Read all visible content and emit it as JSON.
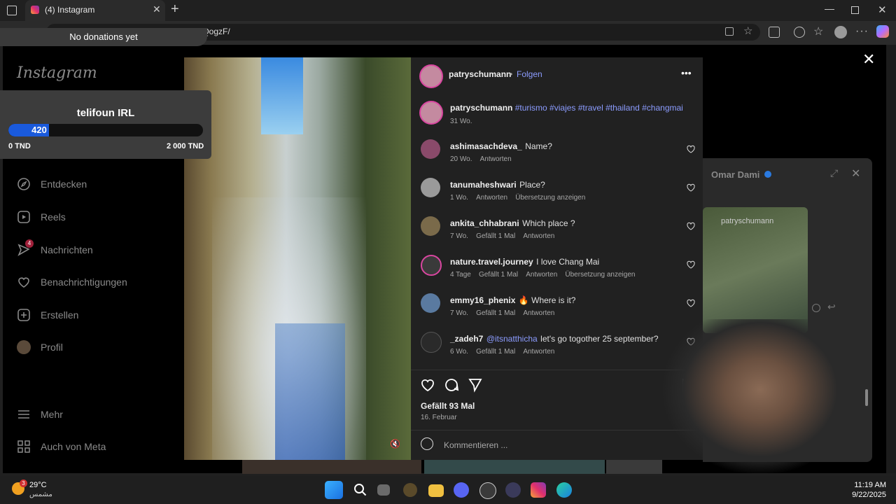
{
  "browser": {
    "tab_title": "(4) Instagram",
    "url": "/QogzF/",
    "new_tab": "+"
  },
  "stream": {
    "donation_text": "No donations yet",
    "goal_title": "telifoun IRL",
    "goal_current": "420",
    "goal_progress": 0.21,
    "goal_min": "0 TND",
    "goal_max": "2 000 TND"
  },
  "sidebar": {
    "logo": "Instagram",
    "items": [
      {
        "label": "Entdecken",
        "icon": "compass-icon"
      },
      {
        "label": "Reels",
        "icon": "reels-icon"
      },
      {
        "label": "Nachrichten",
        "icon": "messenger-icon",
        "badge": "4"
      },
      {
        "label": "Benachrichtigungen",
        "icon": "heart-icon"
      },
      {
        "label": "Erstellen",
        "icon": "plus-square-icon"
      },
      {
        "label": "Profil",
        "icon": "avatar-icon"
      }
    ],
    "more": "Mehr",
    "meta": "Auch von Meta"
  },
  "post": {
    "author": "patryschumann",
    "dot": "•",
    "follow": "Folgen",
    "caption_user": "patryschumann",
    "caption_tags": "#turismo #viajes #travel #thailand #changmai",
    "caption_age": "31 Wo.",
    "likes": "Gefällt 93 Mal",
    "date": "16. Februar",
    "comment_placeholder": "Kommentieren ..."
  },
  "comments": [
    {
      "user": "ashimasachdeva_",
      "text": "Name?",
      "age": "20 Wo.",
      "likes": "",
      "reply": "Antworten",
      "translate": "",
      "color": "#8a4a6a"
    },
    {
      "user": "tanumaheshwari",
      "text": "Place?",
      "age": "1 Wo.",
      "likes": "",
      "reply": "Antworten",
      "translate": "Übersetzung anzeigen",
      "color": "#9a9a9a"
    },
    {
      "user": "ankita_chhabrani",
      "text": "Which place ?",
      "age": "7 Wo.",
      "likes": "Gefällt 1 Mal",
      "reply": "Antworten",
      "translate": "",
      "color": "#7a6a4a"
    },
    {
      "user": "nature.travel.journey",
      "text": "I love Chang Mai",
      "age": "4 Tage",
      "likes": "Gefällt 1 Mal",
      "reply": "Antworten",
      "translate": "Übersetzung anzeigen",
      "color": "#3a3a3a"
    },
    {
      "user": "emmy16_phenix",
      "text": "🔥 Where is it?",
      "age": "7 Wo.",
      "likes": "Gefällt 1 Mal",
      "reply": "Antworten",
      "translate": "",
      "color": "#5a7aa0"
    },
    {
      "user": "_zadeh7",
      "text": "let's go togother 25 september?",
      "mention": "@itsnatthicha",
      "age": "6 Wo.",
      "likes": "Gefällt 1 Mal",
      "reply": "Antworten",
      "translate": "",
      "color": "#2a2a2a"
    }
  ],
  "chat_popup": {
    "name": "Omar Dami",
    "shared_user": "patryschumann"
  },
  "taskbar": {
    "temp": "29°C",
    "weather": "مشمس",
    "weather_badge": "3",
    "time": "11:19 AM",
    "date": "9/22/2025"
  },
  "colors": {
    "accent": "#8c9cff",
    "panel": "#212121",
    "bg": "#000000"
  }
}
